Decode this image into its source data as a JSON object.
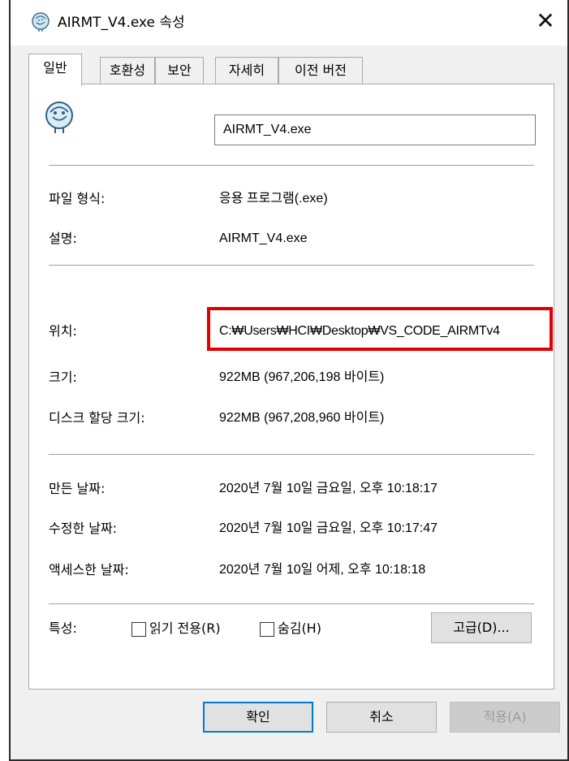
{
  "window": {
    "title": "AIRMT_V4.exe 속성",
    "close": "✕"
  },
  "tabs": [
    "일반",
    "호환성",
    "보안",
    "자세히",
    "이전 버전"
  ],
  "general": {
    "file_name": "AIRMT_V4.exe",
    "file_type_label": "파일 형식:",
    "file_type_value": "응용 프로그램(.exe)",
    "description_label": "설명:",
    "description_value": "AIRMT_V4.exe",
    "location_label": "위치:",
    "location_value": "C:₩Users₩HCI₩Desktop₩VS_CODE_AIRMTv4",
    "size_label": "크기:",
    "size_value": "922MB (967,206,198 바이트)",
    "disk_size_label": "디스크 할당 크기:",
    "disk_size_value": "922MB (967,208,960 바이트)",
    "created_label": "만든 날짜:",
    "created_value": "2020년 7월 10일 금요일, 오후 10:18:17",
    "modified_label": "수정한 날짜:",
    "modified_value": "2020년 7월 10일 금요일, 오후 10:17:47",
    "accessed_label": "액세스한 날짜:",
    "accessed_value": "2020년 7월 10일 어제, 오후 10:18:18",
    "attributes_label": "특성:",
    "readonly_label": "읽기 전용(R)",
    "hidden_label": "숨김(H)",
    "advanced_button": "고급(D)..."
  },
  "footer": {
    "ok": "확인",
    "cancel": "취소",
    "apply": "적용(A)"
  },
  "colors": {
    "highlight": "#e00000",
    "accent": "#0078d7"
  }
}
